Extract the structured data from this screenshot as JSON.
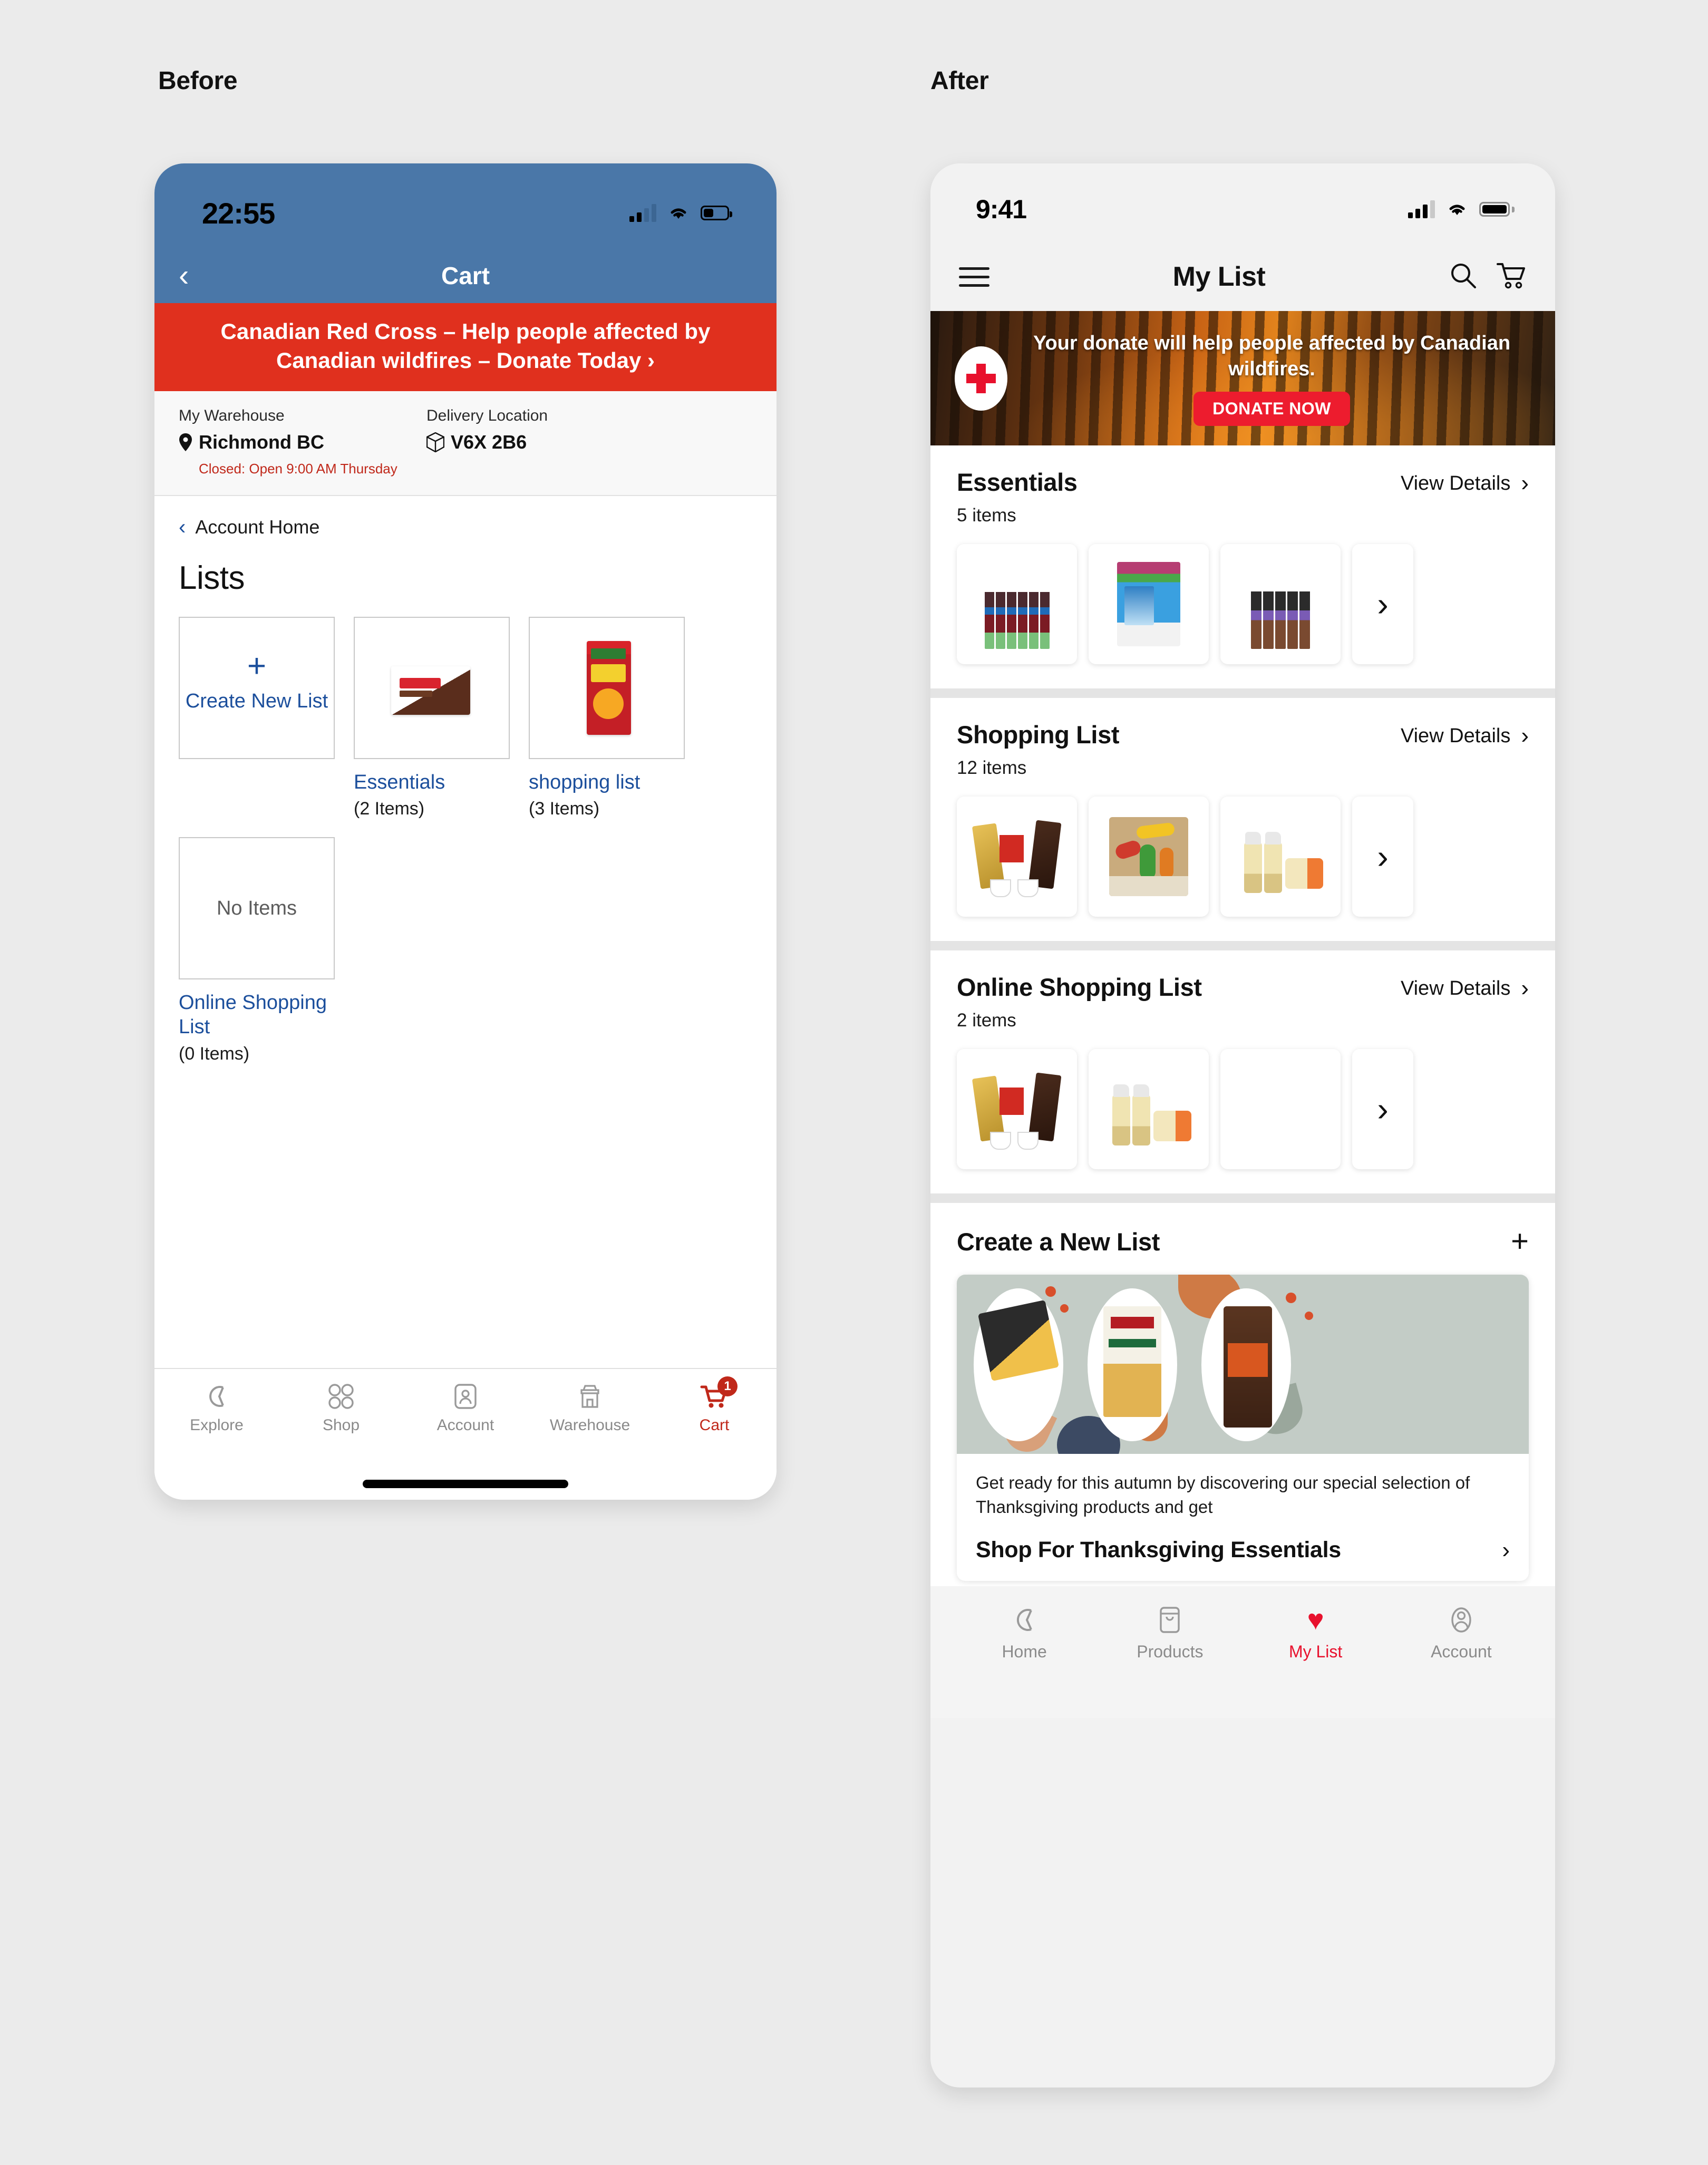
{
  "captions": {
    "before": "Before",
    "after": "After"
  },
  "before": {
    "status": {
      "time": "22:55"
    },
    "navbar": {
      "title": "Cart",
      "back_icon": "chevron-left-icon"
    },
    "banner": {
      "text": "Canadian Red Cross – Help people affected by Canadian wildfires – Donate Today ›"
    },
    "warehouse": {
      "warehouse_label": "My Warehouse",
      "warehouse_value": "Richmond BC",
      "delivery_label": "Delivery Location",
      "delivery_value": "V6X 2B6",
      "closed_note": "Closed: Open 9:00 AM Thursday"
    },
    "breadcrumb": "Account Home",
    "page_title": "Lists",
    "create_card": {
      "label": "Create New List",
      "plus_icon": "plus-icon"
    },
    "cards": [
      {
        "name": "Essentials",
        "count": "(2 Items)",
        "thumb": "premier-protein-box"
      },
      {
        "name": "shopping list",
        "count": "(3 Items)",
        "thumb": "froot-loops-box"
      },
      {
        "name": "Online Shopping List",
        "count": "(0 Items)",
        "thumb": "no-items",
        "empty_label": "No Items"
      }
    ],
    "tabs": [
      {
        "label": "Explore",
        "icon": "costco-c-icon",
        "active": false
      },
      {
        "label": "Shop",
        "icon": "four-circles-icon",
        "active": false
      },
      {
        "label": "Account",
        "icon": "account-card-icon",
        "active": false
      },
      {
        "label": "Warehouse",
        "icon": "store-icon",
        "active": false
      },
      {
        "label": "Cart",
        "icon": "cart-icon",
        "active": true,
        "badge": "1"
      }
    ]
  },
  "after": {
    "status": {
      "time": "9:41"
    },
    "navbar": {
      "menu_icon": "hamburger-icon",
      "title": "My List",
      "search_icon": "search-icon",
      "cart_icon": "cart-icon"
    },
    "donate_banner": {
      "logo": "red-cross-icon",
      "text": "Your donate will help people affected by Canadian wildfires.",
      "button_label": "DONATE NOW",
      "button_color": "#ed1c2e"
    },
    "view_details_label": "View Details",
    "sections": [
      {
        "title": "Essentials",
        "count": "5 items",
        "products": [
          "oasis-juice-pack",
          "almond-breeze-box",
          "natrel-chocolate-milk-pack"
        ]
      },
      {
        "title": "Shopping List",
        "count": "12 items",
        "products": [
          "fantini-coffee-set",
          "veggie-dog-toys-crate",
          "nellies-laundry-spray"
        ]
      },
      {
        "title": "Online Shopping List",
        "count": "2 items",
        "products": [
          "fantini-coffee-set",
          "nellies-laundry-spray"
        ]
      }
    ],
    "create_list": {
      "title": "Create a New List",
      "plus_icon": "plus-icon"
    },
    "thanksgiving": {
      "description": "Get ready for this autumn by discovering our special selection of Thanksgiving products and get",
      "cta_label": "Shop For Thanksgiving Essentials",
      "products": [
        "turkey-meal-kit",
        "kirkland-organic-chicken-broth",
        "kirkland-pecans"
      ]
    },
    "tabs": [
      {
        "label": "Home",
        "icon": "costco-c-icon",
        "active": false
      },
      {
        "label": "Products",
        "icon": "products-bag-icon",
        "active": false
      },
      {
        "label": "My List",
        "icon": "heart-icon",
        "active": true
      },
      {
        "label": "Account",
        "icon": "account-avatar-icon",
        "active": false
      }
    ]
  },
  "colors": {
    "accent_red": "#e8112d",
    "before_header_blue": "#4a77a8",
    "before_banner_red": "#e0301e"
  }
}
